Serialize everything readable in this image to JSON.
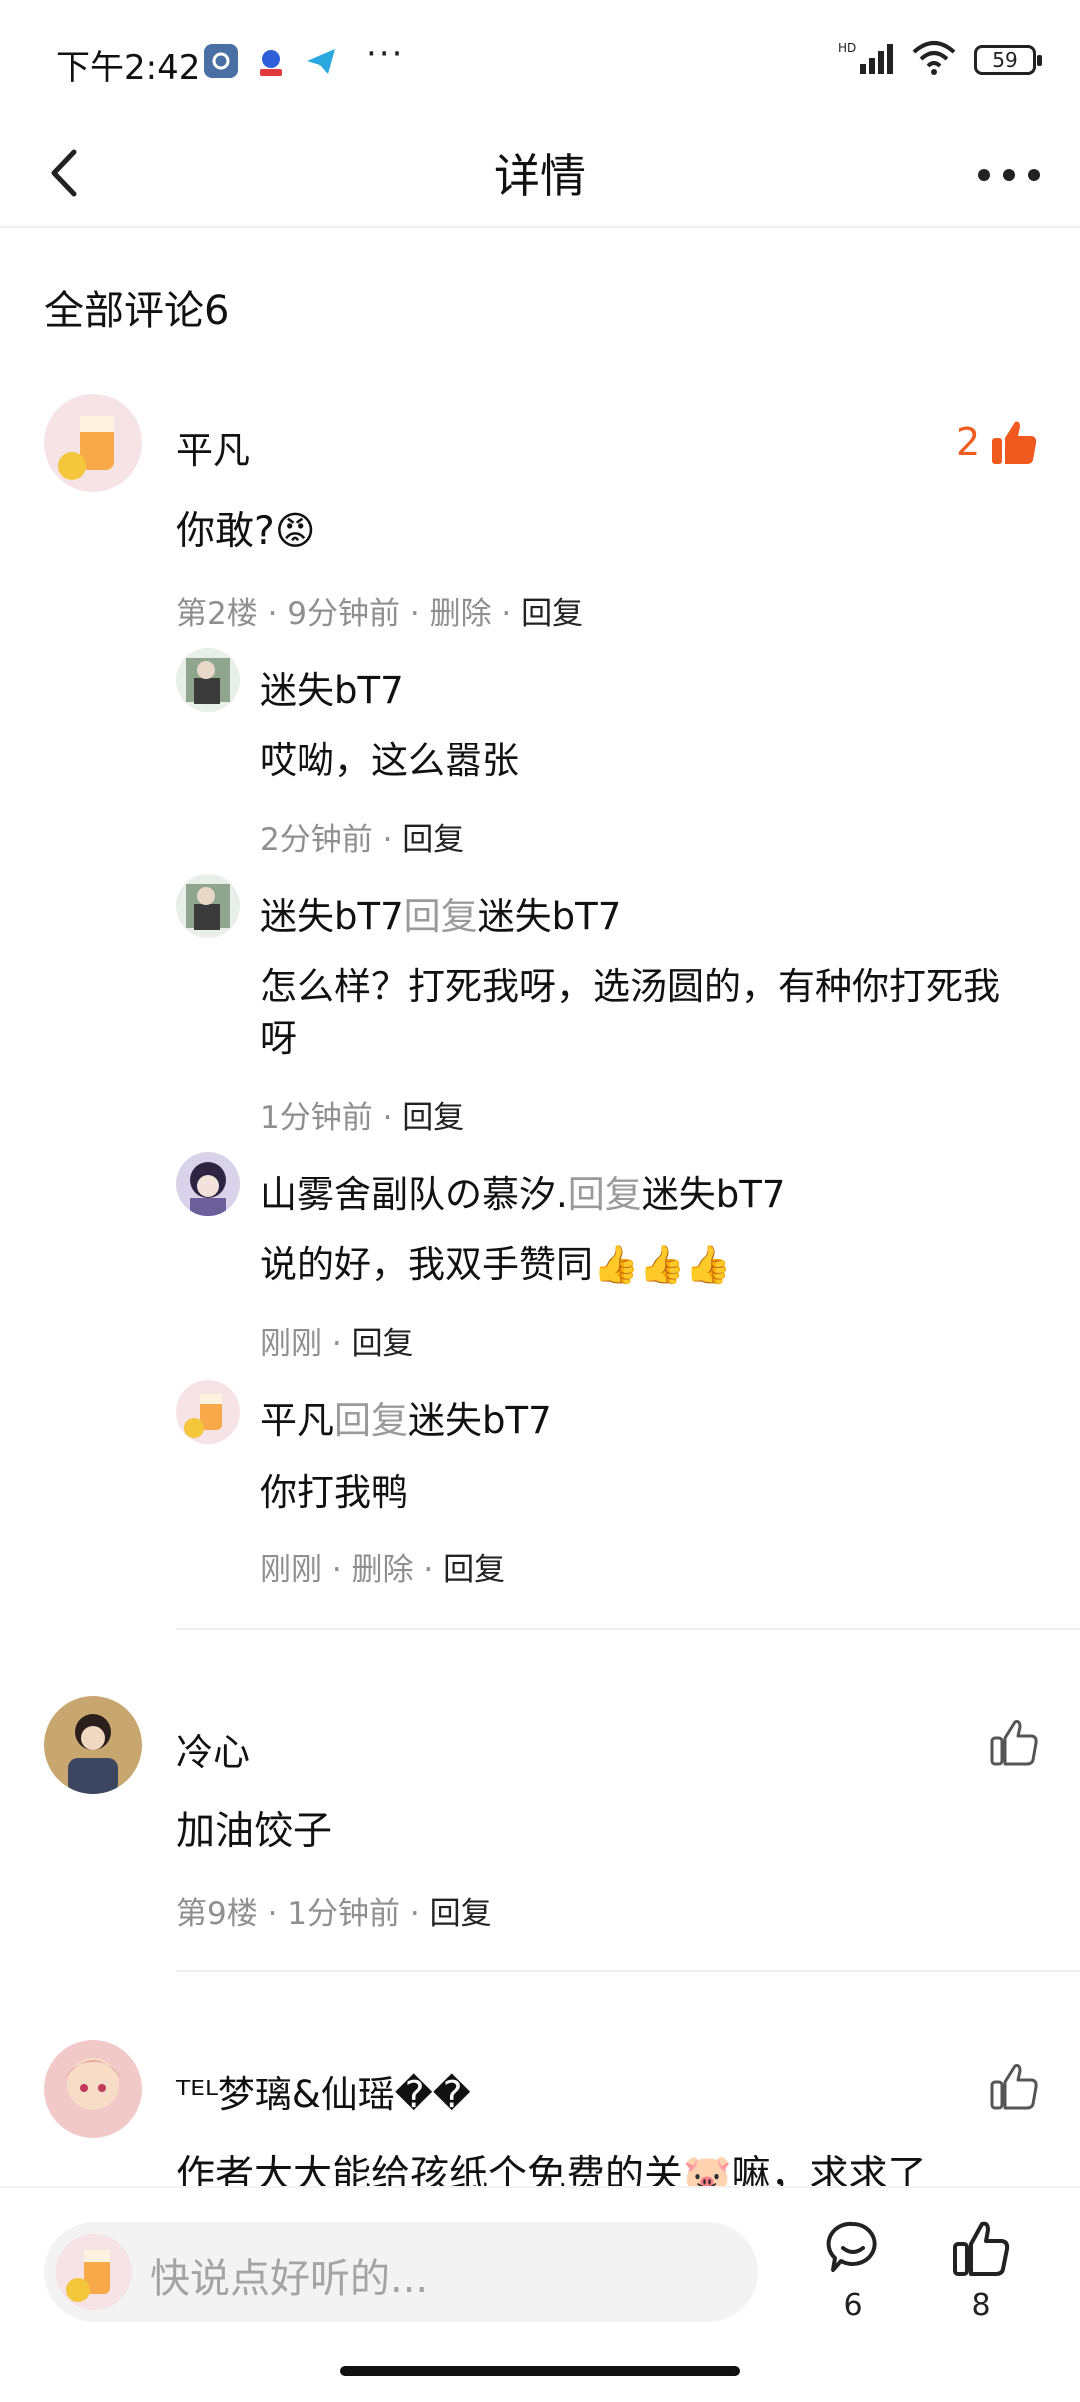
{
  "status": {
    "time": "下午2:42",
    "more": "···",
    "network": "HD",
    "battery": "59"
  },
  "nav": {
    "title": "详情"
  },
  "section": {
    "title": "全部评论6"
  },
  "comments": [
    {
      "name": "平凡",
      "content": "你敢?😡",
      "meta": "第2楼 · 9分钟前 · 删除 · ",
      "reply_label": "回复",
      "like_count": "2",
      "replies": [
        {
          "name": "迷失bT7",
          "reply_word": "",
          "target": "",
          "content": "哎呦，这么嚣张",
          "meta": "2分钟前 · ",
          "reply_label": "回复"
        },
        {
          "name": "迷失bT7",
          "reply_word": "回复",
          "target": "迷失bT7",
          "content": "怎么样？打死我呀，选汤圆的，有种你打死我",
          "content2": "呀",
          "meta": "1分钟前 · ",
          "reply_label": "回复"
        },
        {
          "name": "山雾舍副队の慕汐.",
          "reply_word": "回复",
          "target": "迷失bT7",
          "content": "说的好，我双手赞同👍👍👍",
          "meta": "刚刚 · ",
          "reply_label": "回复"
        },
        {
          "name": "平凡",
          "reply_word": "回复",
          "target": "迷失bT7",
          "content": "你打我鸭",
          "meta": "刚刚 · 删除 · ",
          "reply_label": "回复"
        }
      ]
    },
    {
      "name": "冷心",
      "content": "加油饺子",
      "meta": "第9楼 · 1分钟前 · ",
      "reply_label": "回复"
    },
    {
      "name": "ᵀᴱᴸ梦璃&仙瑶��",
      "content": "作者大大能给孩纸个免费的关🐷嘛，求求了"
    }
  ],
  "bottom": {
    "placeholder": "快说点好听的...",
    "comment_count": "6",
    "like_count": "8"
  },
  "colors": {
    "accent": "#f05a1f",
    "muted": "#8f8f8f"
  }
}
